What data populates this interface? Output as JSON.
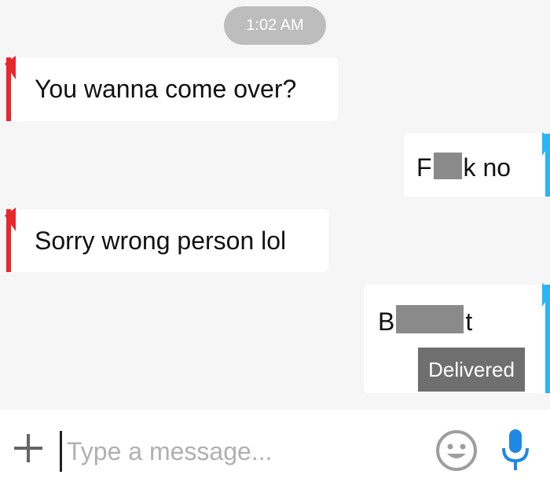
{
  "timestamp": "1:02 AM",
  "messages": [
    {
      "side": "incoming",
      "text": "You wanna come over?"
    },
    {
      "side": "outgoing",
      "text_a": "F",
      "text_b": "k no"
    },
    {
      "side": "incoming",
      "text": "Sorry wrong person lol"
    },
    {
      "side": "outgoing",
      "text_a": "B",
      "text_b": "t",
      "status": "Delivered"
    }
  ],
  "composer": {
    "placeholder": "Type a message...",
    "plus_icon": "plus-icon",
    "emoji_icon": "emoji-icon",
    "mic_icon": "microphone-icon"
  },
  "colors": {
    "incoming_accent": "#e8272c",
    "outgoing_accent": "#29b6f6",
    "mic": "#1e88e5"
  }
}
